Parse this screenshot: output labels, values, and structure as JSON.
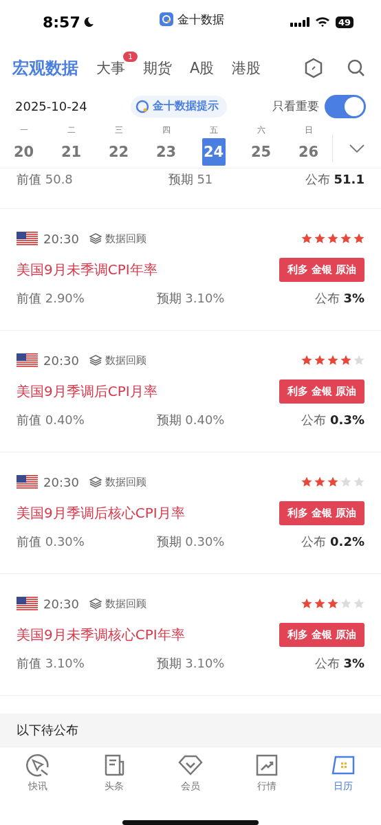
{
  "status_bar": {
    "time": "8:57",
    "app_name": "金十数据",
    "battery": "49"
  },
  "tabs": [
    {
      "label": "宏观数据",
      "selected": true
    },
    {
      "label": "大事",
      "selected": false,
      "badge": "1"
    },
    {
      "label": "期货",
      "selected": false
    },
    {
      "label": "A股",
      "selected": false
    },
    {
      "label": "港股",
      "selected": false
    }
  ],
  "date_bar": {
    "date": "2025-10-24",
    "hint": "金十数据提示",
    "filter_label": "只看重要",
    "filter_on": true
  },
  "week": [
    {
      "weekday": "一",
      "day": "20",
      "selected": false
    },
    {
      "weekday": "二",
      "day": "21",
      "selected": false
    },
    {
      "weekday": "三",
      "day": "22",
      "selected": false
    },
    {
      "weekday": "四",
      "day": "23",
      "selected": false
    },
    {
      "weekday": "五",
      "day": "24",
      "selected": true
    },
    {
      "weekday": "六",
      "day": "25",
      "selected": false
    },
    {
      "weekday": "日",
      "day": "26",
      "selected": false
    }
  ],
  "partial_row": {
    "previous_label": "前值",
    "previous": "50.8",
    "forecast_label": "预期",
    "forecast": "51",
    "actual_label": "公布",
    "actual": "51.1"
  },
  "events": [
    {
      "time": "20:30",
      "review": "数据回顾",
      "stars": 5,
      "title": "美国9月未季调CPI年率",
      "impact": "利多 金银 原油",
      "previous_label": "前值",
      "previous": "2.90%",
      "forecast_label": "预期",
      "forecast": "3.10%",
      "actual_label": "公布",
      "actual": "3%"
    },
    {
      "time": "20:30",
      "review": "数据回顾",
      "stars": 4,
      "title": "美国9月季调后CPI月率",
      "impact": "利多 金银 原油",
      "previous_label": "前值",
      "previous": "0.40%",
      "forecast_label": "预期",
      "forecast": "0.40%",
      "actual_label": "公布",
      "actual": "0.3%"
    },
    {
      "time": "20:30",
      "review": "数据回顾",
      "stars": 3,
      "title": "美国9月季调后核心CPI月率",
      "impact": "利多 金银 原油",
      "previous_label": "前值",
      "previous": "0.30%",
      "forecast_label": "预期",
      "forecast": "0.30%",
      "actual_label": "公布",
      "actual": "0.2%"
    },
    {
      "time": "20:30",
      "review": "数据回顾",
      "stars": 3,
      "title": "美国9月未季调核心CPI年率",
      "impact": "利多 金银 原油",
      "previous_label": "前值",
      "previous": "3.10%",
      "forecast_label": "预期",
      "forecast": "3.10%",
      "actual_label": "公布",
      "actual": "3%"
    }
  ],
  "section_header": "以下待公布",
  "bottom_nav": [
    {
      "label": "快讯",
      "selected": false
    },
    {
      "label": "头条",
      "selected": false
    },
    {
      "label": "会员",
      "selected": false
    },
    {
      "label": "行情",
      "selected": false
    },
    {
      "label": "日历",
      "selected": true
    }
  ]
}
